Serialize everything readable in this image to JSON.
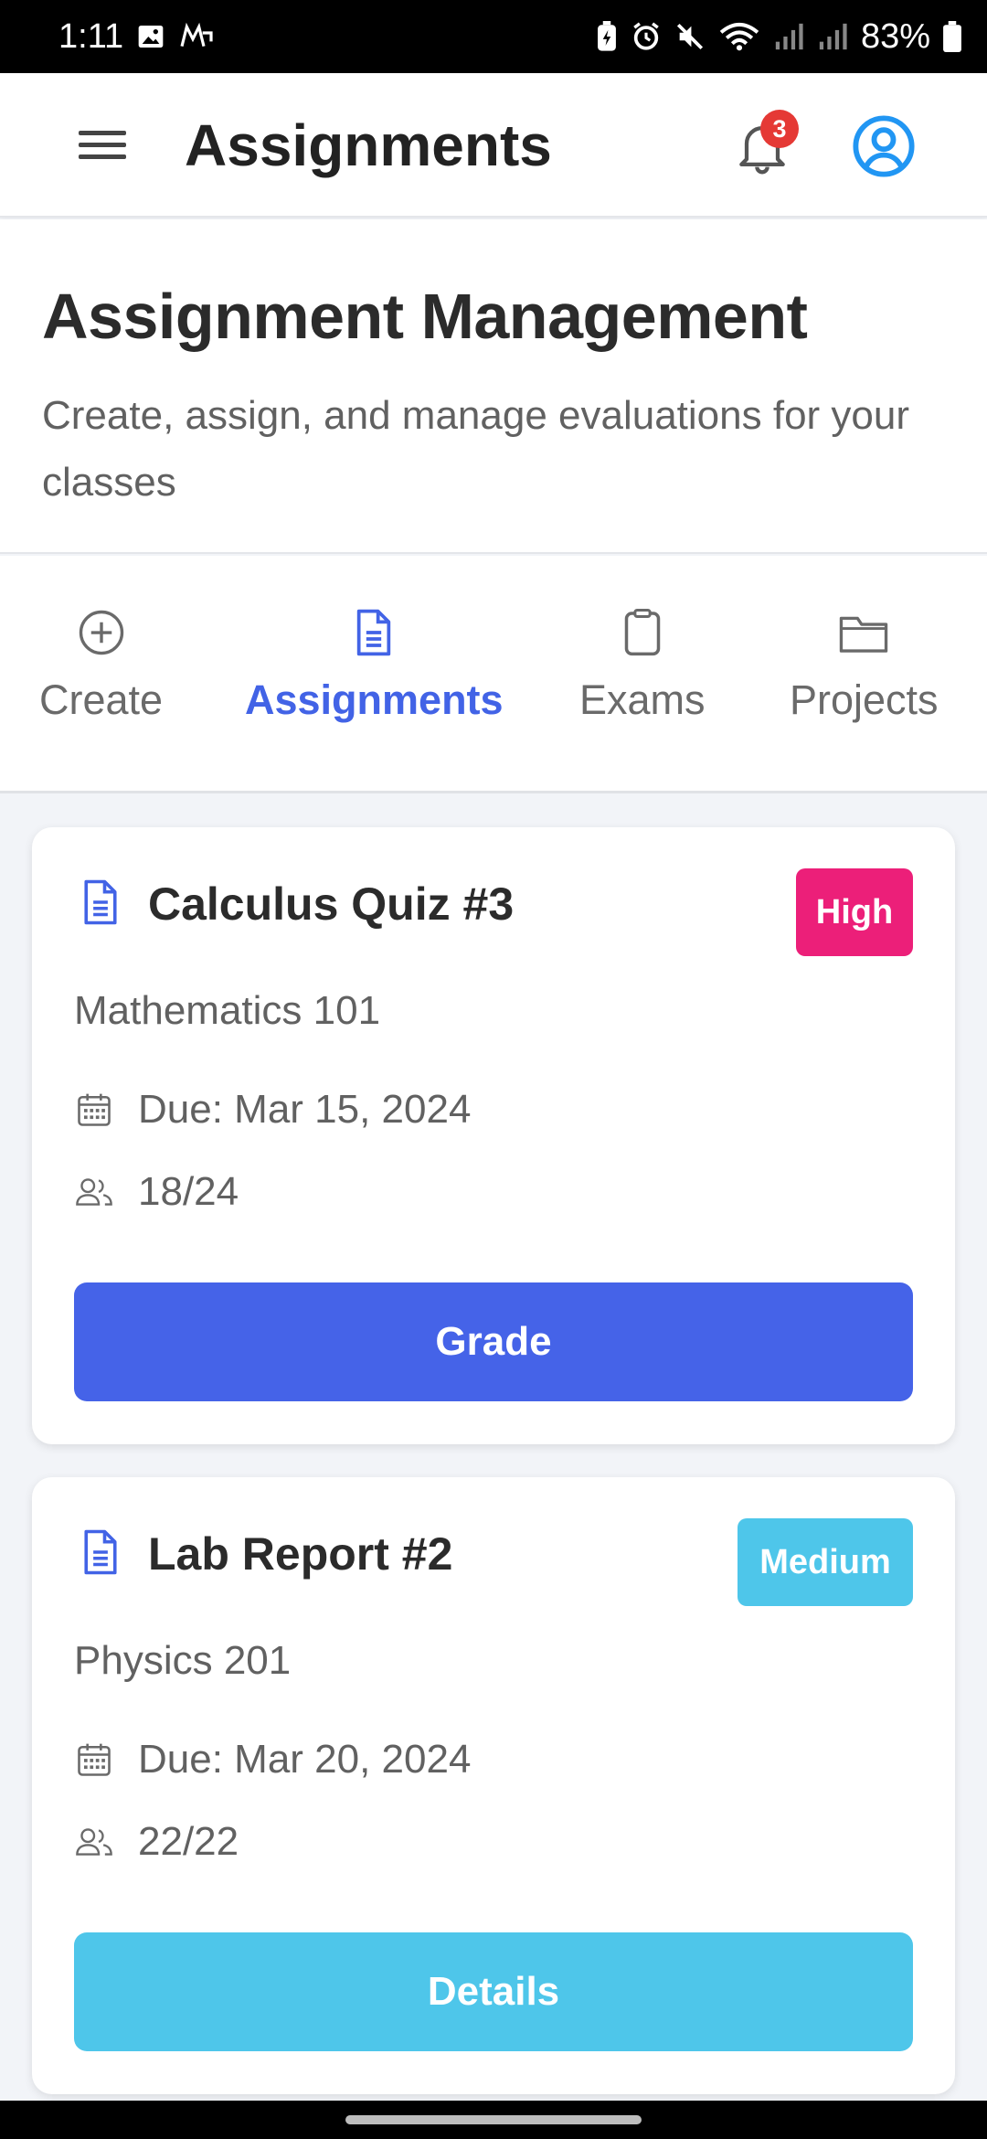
{
  "status_bar": {
    "time": "1:11",
    "battery": "83%",
    "icons": [
      "image-icon",
      "cloud-sync-icon",
      "battery-saver-icon",
      "alarm-icon",
      "mute-icon",
      "wifi-icon",
      "signal-icon",
      "signal-icon",
      "battery-icon"
    ]
  },
  "app_bar": {
    "title": "Assignments",
    "notification_count": "3",
    "icons": [
      "menu-icon",
      "bell-icon",
      "profile-icon"
    ]
  },
  "header": {
    "title": "Assignment Management",
    "subtitle": "Create, assign, and manage evaluations for your classes"
  },
  "tabs": [
    {
      "label": "Create",
      "icon": "plus-circle-icon",
      "active": false
    },
    {
      "label": "Assignments",
      "icon": "document-icon",
      "active": true
    },
    {
      "label": "Exams",
      "icon": "clipboard-icon",
      "active": false
    },
    {
      "label": "Projects",
      "icon": "folder-icon",
      "active": false
    }
  ],
  "assignments": [
    {
      "title": "Calculus Quiz #3",
      "priority": "High",
      "priority_color": "#ec1f79",
      "subject": "Mathematics 101",
      "due": "Due: Mar 15, 2024",
      "submissions": "18/24",
      "action": "Grade",
      "action_color": "#4563e8"
    },
    {
      "title": "Lab Report #2",
      "priority": "Medium",
      "priority_color": "#4ec6ea",
      "subject": "Physics 201",
      "due": "Due: Mar 20, 2024",
      "submissions": "22/22",
      "action": "Details",
      "action_color": "#4ec6ea"
    }
  ],
  "colors": {
    "accent": "#4263e6",
    "text_primary": "#2b2b2b",
    "text_secondary": "#616161"
  }
}
